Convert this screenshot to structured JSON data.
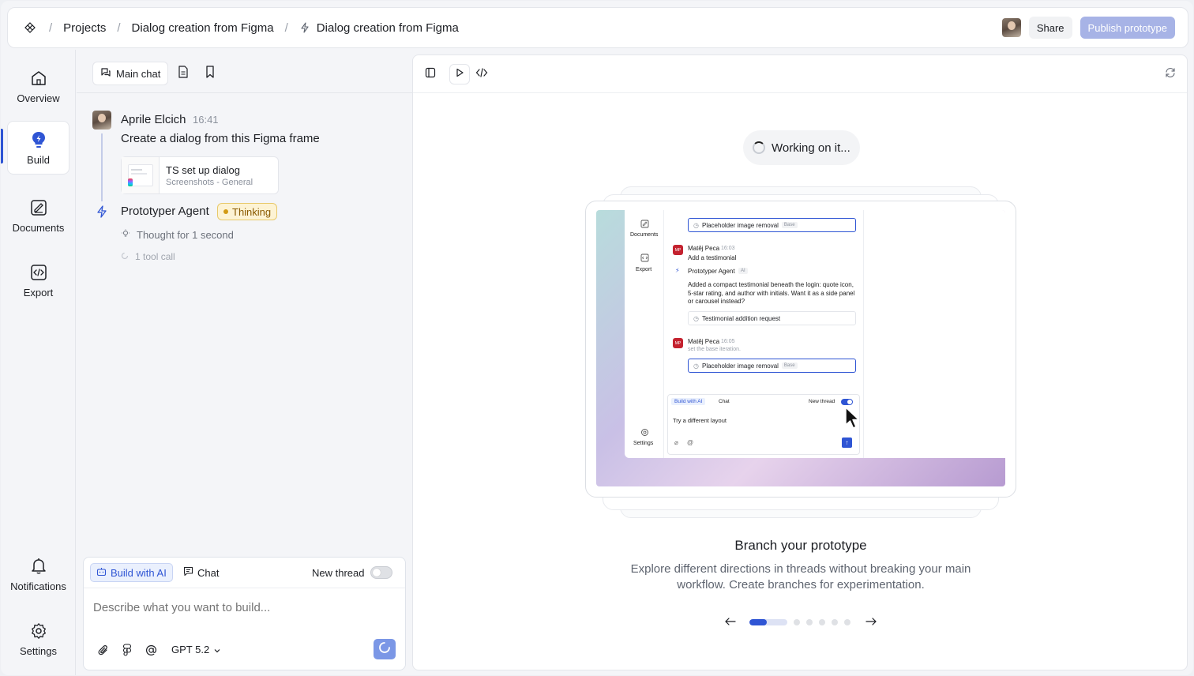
{
  "breadcrumb": {
    "projects": "Projects",
    "project": "Dialog creation from Figma",
    "page": "Dialog creation from Figma"
  },
  "header": {
    "share_label": "Share",
    "publish_label": "Publish prototype"
  },
  "sidebar": {
    "items": [
      {
        "label": "Overview",
        "icon": "home-icon"
      },
      {
        "label": "Build",
        "icon": "lightbulb-icon",
        "active": true
      },
      {
        "label": "Documents",
        "icon": "documents-icon"
      },
      {
        "label": "Export",
        "icon": "code-icon"
      }
    ],
    "bottom": [
      {
        "label": "Notifications",
        "icon": "bell-icon"
      },
      {
        "label": "Settings",
        "icon": "gear-icon"
      }
    ]
  },
  "chat": {
    "tab_main": "Main chat",
    "messages": {
      "user_name": "Aprile Elcich",
      "user_time": "16:41",
      "user_text": "Create a dialog from this Figma frame",
      "attachment_title": "TS set up dialog",
      "attachment_sub": "Screenshots - General",
      "agent_name": "Prototyper Agent",
      "agent_status": "Thinking",
      "thought": "Thought for 1 second",
      "tool_call": "1 tool call"
    },
    "composer": {
      "mode_build": "Build with AI",
      "mode_chat": "Chat",
      "new_thread": "New thread",
      "new_thread_on": false,
      "placeholder": "Describe what you want to build...",
      "model": "GPT 5.2"
    }
  },
  "preview": {
    "working": "Working on it...",
    "branch_title": "Branch your prototype",
    "branch_desc": "Explore different directions in threads without breaking your main workflow. Create branches for experimentation.",
    "carousel": {
      "pages": 7,
      "current": 1
    },
    "screenshot": {
      "nav_documents": "Documents",
      "nav_export": "Export",
      "nav_settings": "Settings",
      "card1": "Placeholder image removal",
      "card1_tag": "Base",
      "msg1_author": "Matěj Peca",
      "msg1_time": "16:03",
      "msg1_text": "Add a testimonial",
      "agent": "Prototyper Agent",
      "agent_tag": "AI",
      "agent_text": "Added a compact testimonial beneath the login: quote icon, 5-star rating, and author with initials. Want it as a side panel or carousel instead?",
      "card2": "Testimonial addition request",
      "msg2_author": "Matěj Peca",
      "msg2_time": "16:05",
      "msg2_text": "set the base iteration.",
      "card3": "Placeholder image removal",
      "card3_tag": "Base",
      "mode_build": "Build with AI",
      "mode_chat": "Chat",
      "new_thread": "New thread",
      "prompt": "Try a different layout",
      "initials": "MP"
    }
  },
  "colors": {
    "accent": "#2f55d4",
    "publish_bg": "#a7b3e6",
    "thinking_bg": "#fdf3d4"
  }
}
